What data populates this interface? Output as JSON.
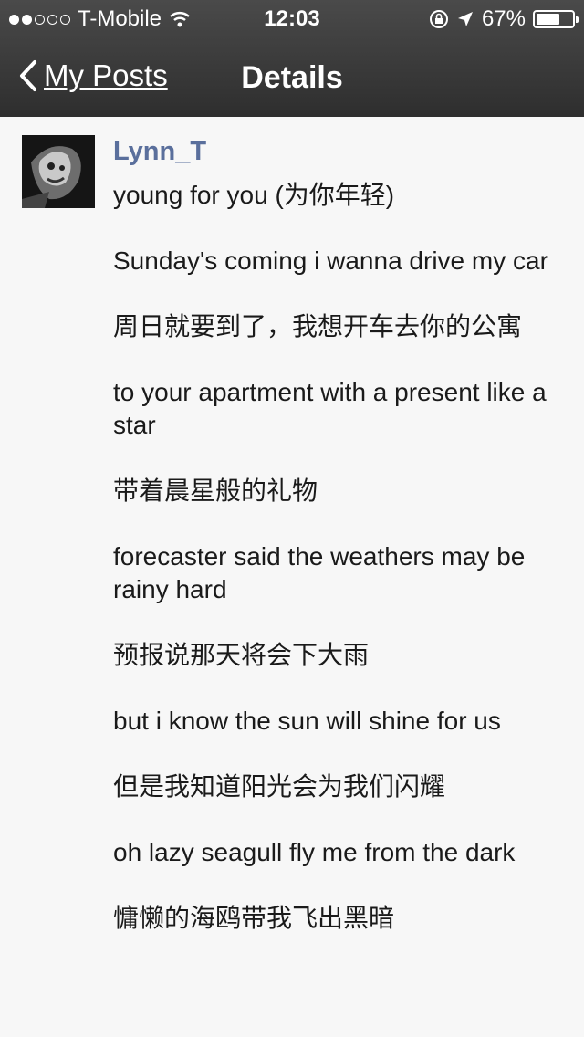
{
  "status_bar": {
    "carrier": "T-Mobile",
    "time": "12:03",
    "battery": "67%",
    "battery_level": 0.67
  },
  "nav": {
    "back_label": "My Posts",
    "title": "Details"
  },
  "post": {
    "author": "Lynn_T",
    "lines": [
      "young for you (为你年轻)",
      "Sunday's coming i wanna drive my car",
      "周日就要到了，我想开车去你的公寓",
      "to your apartment with a present like a star",
      "带着晨星般的礼物",
      "forecaster said the weathers may be rainy hard",
      "预报说那天将会下大雨",
      "but i know the sun will shine for us",
      "但是我知道阳光会为我们闪耀",
      "oh lazy seagull fly me from the dark",
      "慵懒的海鸥带我飞出黑暗"
    ]
  }
}
